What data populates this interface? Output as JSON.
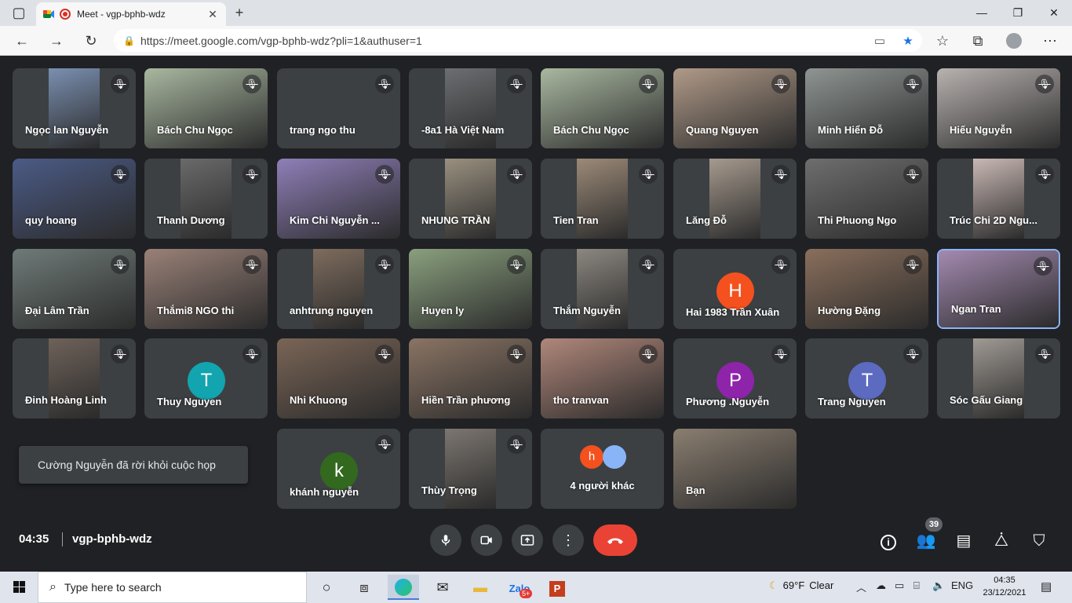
{
  "browser": {
    "tab_title": "Meet - vgp-bphb-wdz",
    "url": "https://meet.google.com/vgp-bphb-wdz?pli=1&authuser=1"
  },
  "tiles": [
    {
      "name": "Ngọc lan Nguyễn",
      "bg": "#7a8fb0"
    },
    {
      "name": "Bách Chu Ngọc",
      "bg": "#a9b8a0"
    },
    {
      "name": "trang ngo thu",
      "bg": "#3c4043"
    },
    {
      "name": "-8a1 Hà Việt Nam",
      "bg": "#6d6e72"
    },
    {
      "name": "Bách Chu Ngọc",
      "bg": "#a9b8a0"
    },
    {
      "name": "Quang Nguyen",
      "bg": "#b09a88"
    },
    {
      "name": "Minh Hiển Đỗ",
      "bg": "#8f9592"
    },
    {
      "name": "Hiếu Nguyễn",
      "bg": "#b8b2b0"
    },
    {
      "name": "quy hoang",
      "bg": "#4b5b86"
    },
    {
      "name": "Thanh Dương",
      "bg": "#6a6a6a"
    },
    {
      "name": "Kim Chi Nguyễn ...",
      "bg": "#8f7fb8"
    },
    {
      "name": "NHUNG TRẦN",
      "bg": "#9a9080"
    },
    {
      "name": "Tien Tran",
      "bg": "#9c8a78"
    },
    {
      "name": "Lăng Đỗ",
      "bg": "#a69a8e"
    },
    {
      "name": "Thi Phuong Ngo",
      "bg": "#6e6e6e"
    },
    {
      "name": "Trúc Chi 2D Ngu...",
      "bg": "#c9b8b4"
    },
    {
      "name": "Đại Lâm Trần",
      "bg": "#6f7b78"
    },
    {
      "name": "Thắmi8 NGO thi",
      "bg": "#9a8178"
    },
    {
      "name": "anhtrung nguyen",
      "bg": "#7e6c5e"
    },
    {
      "name": "Huyen ly",
      "bg": "#8aa07e"
    },
    {
      "name": "Thắm Nguyễn",
      "bg": "#8c8780"
    },
    {
      "name": "Hai 1983 Trần Xuân",
      "bg": "#3c4043"
    },
    {
      "name": "Hường Đặng",
      "bg": "#8a6f5c"
    },
    {
      "name": "Ngan Tran",
      "bg": "#a48ab0"
    },
    {
      "name": "Đinh Hoàng Linh",
      "bg": "#6e625a"
    },
    {
      "name": "Thuy Nguyen",
      "bg": "#3c4043"
    },
    {
      "name": "Nhi Khuong",
      "bg": "#7a6556"
    },
    {
      "name": "Hiền Trần phương",
      "bg": "#8a7464"
    },
    {
      "name": "tho tranvan",
      "bg": "#b0877a"
    },
    {
      "name": "Phương .Nguyễn",
      "bg": "#3c4043"
    },
    {
      "name": "Trang Nguyen",
      "bg": "#3c4043"
    },
    {
      "name": "Sóc Gấu Giang",
      "bg": "#a09a94"
    },
    {
      "name": "khánh nguyễn",
      "bg": "#3c4043"
    },
    {
      "name": "Thùy Trọng",
      "bg": "#7c7670"
    },
    {
      "name": "4 người khác",
      "bg": "#3c4043"
    },
    {
      "name": "Bạn",
      "bg": "#8a7e70"
    }
  ],
  "avatars": {
    "hai": {
      "letter": "H",
      "color": "#f4511e"
    },
    "thuy": {
      "letter": "T",
      "color": "#12a4af"
    },
    "phuong": {
      "letter": "P",
      "color": "#8e24aa"
    },
    "trang": {
      "letter": "T",
      "color": "#5c6bc0"
    },
    "khanh": {
      "letter": "k",
      "color": "#33691e"
    },
    "others_h": {
      "letter": "h",
      "color": "#f4511e"
    }
  },
  "toast": "Cường Nguyễn đã rời khỏi cuộc họp",
  "meeting": {
    "time": "04:35",
    "code": "vgp-bphb-wdz",
    "participant_count": "39"
  },
  "taskbar": {
    "search_placeholder": "Type here to search",
    "temperature": "69°F",
    "weather": "Clear",
    "language": "ENG",
    "time": "04:35",
    "date": "23/12/2021",
    "mail_badge": "5+"
  },
  "colors": {
    "end_call": "#ea4335",
    "meet_bg": "#202124",
    "active_border": "#8ab4f8"
  }
}
